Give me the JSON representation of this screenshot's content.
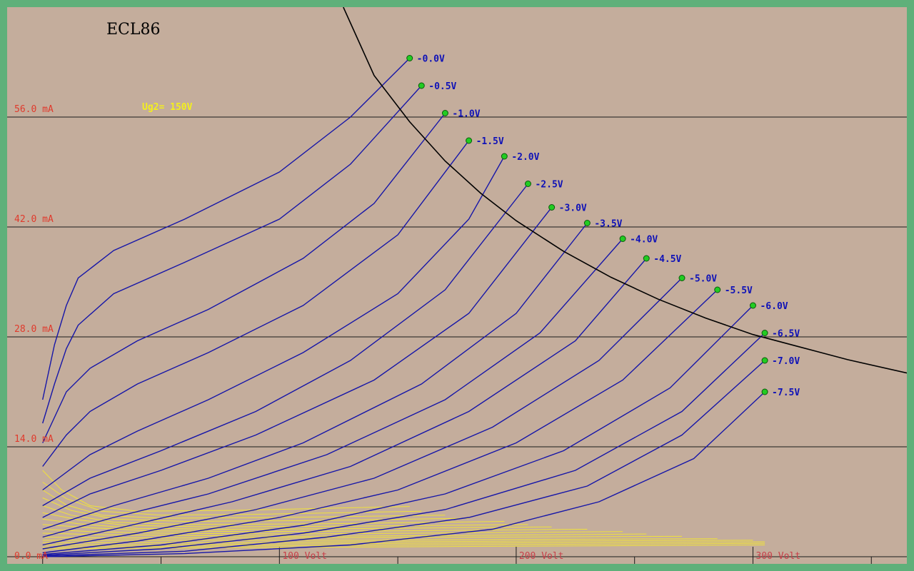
{
  "colors": {
    "background": "#c4ad9c",
    "border": "#5fb07a",
    "curve": "#1616a8",
    "screen_curve": "#f0e23a",
    "label": "#0f12b7",
    "axis_label": "#e03a2c",
    "marker": "#22cc22",
    "load_line": "#000000"
  },
  "chart_data": {
    "type": "line",
    "title": "ECL86",
    "parameter_label": "Ug2= 150V",
    "x_unit": "Volt",
    "y_unit": "mA",
    "xlim": [
      -15,
      365
    ],
    "ylim": [
      0,
      70
    ],
    "x_ticks": [
      {
        "value": 100,
        "label": "100 Volt"
      },
      {
        "value": 200,
        "label": "200 Volt"
      },
      {
        "value": 300,
        "label": "300 Volt"
      }
    ],
    "x_minor_ticks": [
      0,
      50,
      150,
      250,
      350
    ],
    "y_ticks": [
      {
        "value": 0,
        "label": "0.0 mA"
      },
      {
        "value": 14,
        "label": "14.0 mA"
      },
      {
        "value": 28,
        "label": "28.0 mA"
      },
      {
        "value": 42,
        "label": "42.0 mA"
      },
      {
        "value": 56,
        "label": "56.0 mA"
      }
    ],
    "grid": true,
    "load_line": {
      "x": [
        127,
        140,
        155,
        170,
        185,
        200,
        220,
        240,
        260,
        280,
        300,
        320,
        340,
        365
      ],
      "y": [
        70,
        61.3,
        55.4,
        50.4,
        46.3,
        42.8,
        38.9,
        35.6,
        32.8,
        30.4,
        28.3,
        26.7,
        25.1,
        23.4
      ]
    },
    "series": [
      {
        "name": "-0.0V",
        "x": [
          0,
          5,
          10,
          15,
          30,
          60,
          100,
          130,
          155
        ],
        "y": [
          20,
          27,
          32,
          35.5,
          39,
          43,
          49,
          56,
          63.5
        ]
      },
      {
        "name": "-0.5V",
        "x": [
          0,
          5,
          10,
          15,
          30,
          60,
          100,
          130,
          160
        ],
        "y": [
          17,
          22,
          26.5,
          29.5,
          33.5,
          37.5,
          43,
          50,
          60
        ]
      },
      {
        "name": "-1.0V",
        "x": [
          0,
          10,
          20,
          40,
          70,
          110,
          140,
          170
        ],
        "y": [
          14.5,
          21,
          24,
          27.5,
          31.5,
          38,
          45,
          56.5
        ]
      },
      {
        "name": "-1.5V",
        "x": [
          0,
          10,
          20,
          40,
          70,
          110,
          150,
          180
        ],
        "y": [
          11.5,
          15.5,
          18.5,
          22,
          26,
          32,
          41,
          53
        ]
      },
      {
        "name": "-2.0V",
        "x": [
          0,
          20,
          40,
          70,
          110,
          150,
          180,
          195
        ],
        "y": [
          8.5,
          13,
          16,
          20,
          26,
          33.5,
          43,
          51
        ]
      },
      {
        "name": "-2.5V",
        "x": [
          0,
          20,
          50,
          90,
          130,
          170,
          205
        ],
        "y": [
          6.5,
          10,
          13.5,
          18.5,
          25,
          34,
          47.5
        ]
      },
      {
        "name": "-3.0V",
        "x": [
          0,
          20,
          50,
          90,
          140,
          180,
          215
        ],
        "y": [
          5,
          8,
          11,
          15.5,
          22.5,
          31,
          44.5
        ]
      },
      {
        "name": "-3.5V",
        "x": [
          0,
          30,
          70,
          110,
          160,
          200,
          230
        ],
        "y": [
          3.5,
          6.5,
          10,
          14.5,
          22,
          31,
          42.5
        ]
      },
      {
        "name": "-4.0V",
        "x": [
          0,
          30,
          70,
          120,
          170,
          210,
          245
        ],
        "y": [
          2.5,
          5,
          8,
          13,
          20,
          28.5,
          40.5
        ]
      },
      {
        "name": "-4.5V",
        "x": [
          0,
          30,
          80,
          130,
          180,
          225,
          255
        ],
        "y": [
          1.5,
          3.5,
          7,
          11.5,
          18.5,
          27.5,
          38
        ]
      },
      {
        "name": "-5.0V",
        "x": [
          0,
          40,
          90,
          140,
          190,
          235,
          270
        ],
        "y": [
          1,
          3,
          6,
          10,
          16.5,
          25,
          35.5
        ]
      },
      {
        "name": "-5.5V",
        "x": [
          0,
          40,
          100,
          150,
          200,
          245,
          285
        ],
        "y": [
          0.5,
          2,
          5,
          8.5,
          14.5,
          22.5,
          34
        ]
      },
      {
        "name": "-6.0V",
        "x": [
          0,
          50,
          110,
          170,
          220,
          265,
          300
        ],
        "y": [
          0.3,
          1.5,
          4,
          8,
          13.5,
          21.5,
          32
        ]
      },
      {
        "name": "-6.5V",
        "x": [
          0,
          50,
          110,
          170,
          225,
          270,
          305
        ],
        "y": [
          0.2,
          1,
          3,
          6,
          11,
          18.5,
          28.5
        ]
      },
      {
        "name": "-7.0V",
        "x": [
          0,
          60,
          120,
          180,
          230,
          270,
          305
        ],
        "y": [
          0.1,
          0.7,
          2.5,
          5,
          9,
          15.5,
          25
        ]
      },
      {
        "name": "-7.5V",
        "x": [
          0,
          60,
          130,
          190,
          235,
          275,
          305
        ],
        "y": [
          0,
          0.4,
          1.5,
          3.5,
          7,
          12.5,
          21
        ]
      }
    ],
    "screen_current_series": [
      {
        "x": [
          0,
          8,
          20,
          40,
          80,
          155
        ],
        "y": [
          11,
          8.5,
          6.5,
          5.8,
          5.9,
          6.4
        ]
      },
      {
        "x": [
          0,
          10,
          25,
          50,
          90,
          160
        ],
        "y": [
          9.5,
          7.4,
          5.8,
          5.3,
          5.4,
          5.8
        ]
      },
      {
        "x": [
          0,
          10,
          25,
          50,
          100,
          170
        ],
        "y": [
          8.5,
          6.6,
          5.3,
          4.9,
          5.0,
          5.3
        ]
      },
      {
        "x": [
          0,
          12,
          30,
          60,
          110,
          180
        ],
        "y": [
          7.5,
          5.9,
          4.8,
          4.5,
          4.6,
          4.9
        ]
      },
      {
        "x": [
          0,
          12,
          30,
          60,
          120,
          195
        ],
        "y": [
          6.5,
          5.3,
          4.4,
          4.1,
          4.2,
          4.5
        ]
      },
      {
        "x": [
          0,
          15,
          35,
          70,
          130,
          205
        ],
        "y": [
          5.6,
          4.7,
          4.0,
          3.8,
          3.9,
          4.1
        ]
      },
      {
        "x": [
          0,
          15,
          40,
          80,
          140,
          215
        ],
        "y": [
          4.8,
          4.2,
          3.6,
          3.5,
          3.6,
          3.8
        ]
      },
      {
        "x": [
          0,
          20,
          45,
          90,
          150,
          230
        ],
        "y": [
          4.1,
          3.7,
          3.3,
          3.2,
          3.3,
          3.5
        ]
      },
      {
        "x": [
          0,
          20,
          50,
          100,
          160,
          245
        ],
        "y": [
          3.5,
          3.2,
          3.0,
          2.9,
          3.0,
          3.2
        ]
      },
      {
        "x": [
          0,
          25,
          60,
          110,
          170,
          255
        ],
        "y": [
          3.0,
          2.8,
          2.7,
          2.6,
          2.7,
          2.9
        ]
      },
      {
        "x": [
          0,
          25,
          60,
          120,
          190,
          270
        ],
        "y": [
          2.5,
          2.4,
          2.4,
          2.4,
          2.5,
          2.6
        ]
      },
      {
        "x": [
          0,
          30,
          70,
          130,
          200,
          285
        ],
        "y": [
          2.1,
          2.1,
          2.1,
          2.1,
          2.2,
          2.3
        ]
      },
      {
        "x": [
          0,
          30,
          80,
          140,
          210,
          300
        ],
        "y": [
          1.8,
          1.8,
          1.8,
          1.9,
          2.0,
          2.1
        ]
      },
      {
        "x": [
          0,
          35,
          90,
          150,
          220,
          305
        ],
        "y": [
          1.5,
          1.5,
          1.6,
          1.7,
          1.8,
          1.9
        ]
      },
      {
        "x": [
          0,
          40,
          100,
          160,
          230,
          305
        ],
        "y": [
          1.2,
          1.3,
          1.4,
          1.5,
          1.6,
          1.7
        ]
      },
      {
        "x": [
          0,
          45,
          110,
          170,
          240,
          305
        ],
        "y": [
          1.0,
          1.1,
          1.2,
          1.3,
          1.4,
          1.5
        ]
      }
    ]
  }
}
